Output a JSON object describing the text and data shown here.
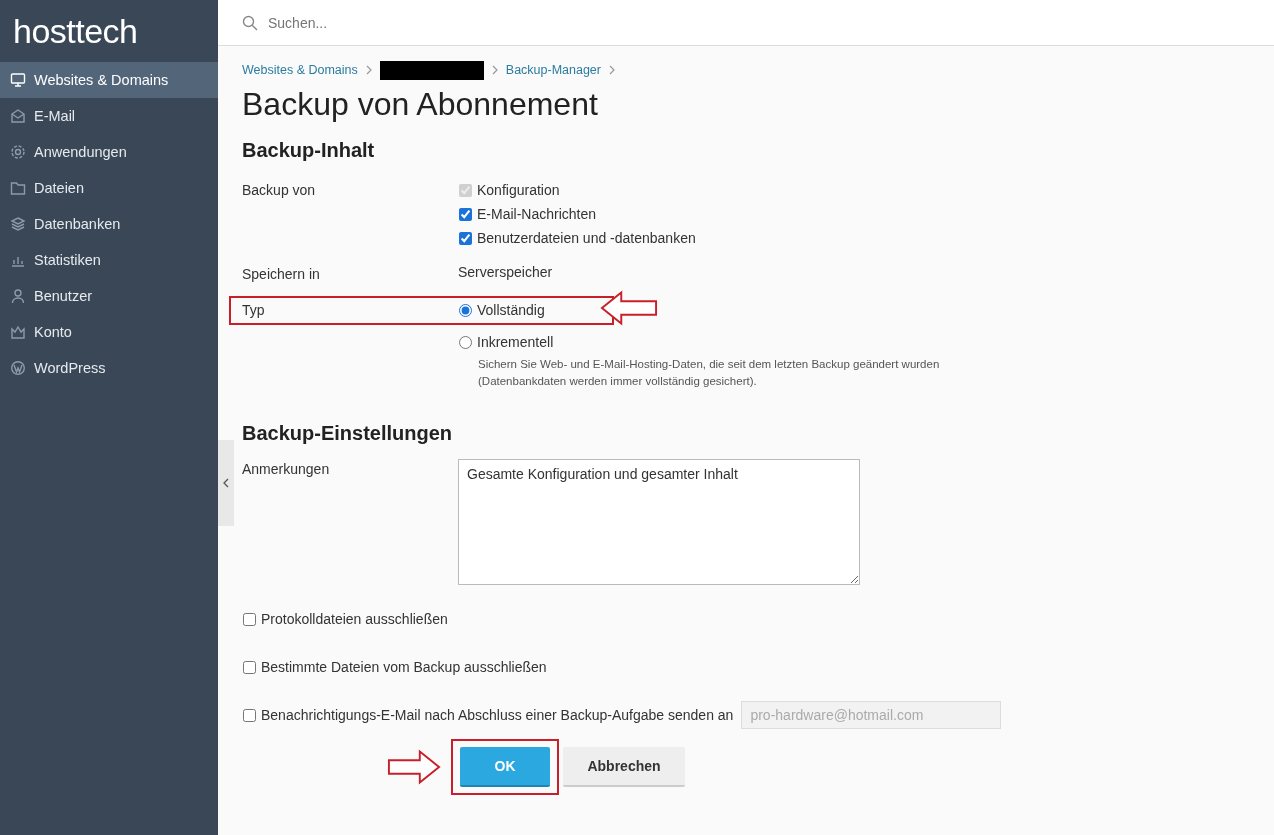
{
  "brand": "hosttech",
  "sidebar": {
    "items": [
      {
        "label": "Websites & Domains",
        "selected": true
      },
      {
        "label": "E-Mail",
        "selected": false
      },
      {
        "label": "Anwendungen",
        "selected": false
      },
      {
        "label": "Dateien",
        "selected": false
      },
      {
        "label": "Datenbanken",
        "selected": false
      },
      {
        "label": "Statistiken",
        "selected": false
      },
      {
        "label": "Benutzer",
        "selected": false
      },
      {
        "label": "Konto",
        "selected": false
      },
      {
        "label": "WordPress",
        "selected": false
      }
    ]
  },
  "search": {
    "placeholder": "Suchen..."
  },
  "breadcrumb": [
    {
      "kind": "link",
      "label": "Websites & Domains"
    },
    {
      "kind": "redacted"
    },
    {
      "kind": "link",
      "label": "Backup-Manager"
    }
  ],
  "title": "Backup von Abonnement",
  "content": {
    "heading": "Backup-Inhalt",
    "backup_of": {
      "label": "Backup von",
      "options": [
        {
          "label": "Konfiguration",
          "checked": true,
          "disabled": true
        },
        {
          "label": "E-Mail-Nachrichten",
          "checked": true,
          "disabled": false
        },
        {
          "label": "Benutzerdateien und -datenbanken",
          "checked": true,
          "disabled": false
        }
      ]
    },
    "store_in": {
      "label": "Speichern in",
      "value": "Serverspeicher"
    },
    "type": {
      "label": "Typ",
      "options": [
        {
          "label": "Vollständig",
          "selected": true
        },
        {
          "label": "Inkrementell",
          "selected": false,
          "hint": "Sichern Sie Web- und E-Mail-Hosting-Daten, die seit dem letzten Backup geändert wurden (Datenbankdaten werden immer vollständig gesichert)."
        }
      ]
    }
  },
  "settings": {
    "heading": "Backup-Einstellungen",
    "notes": {
      "label": "Anmerkungen",
      "value": "Gesamte Konfiguration und gesamter Inhalt"
    },
    "options": [
      {
        "label": "Protokolldateien ausschließen",
        "checked": false
      },
      {
        "label": "Bestimmte Dateien vom Backup ausschließen",
        "checked": false
      },
      {
        "label": "Benachrichtigungs-E-Mail nach Abschluss einer Backup-Aufgabe senden an",
        "checked": false,
        "email": {
          "value": "pro-hardware@hotmail.com",
          "disabled": true
        }
      }
    ]
  },
  "buttons": [
    {
      "label": "OK",
      "kind": "primary"
    },
    {
      "label": "Abbrechen",
      "kind": "secondary"
    }
  ]
}
